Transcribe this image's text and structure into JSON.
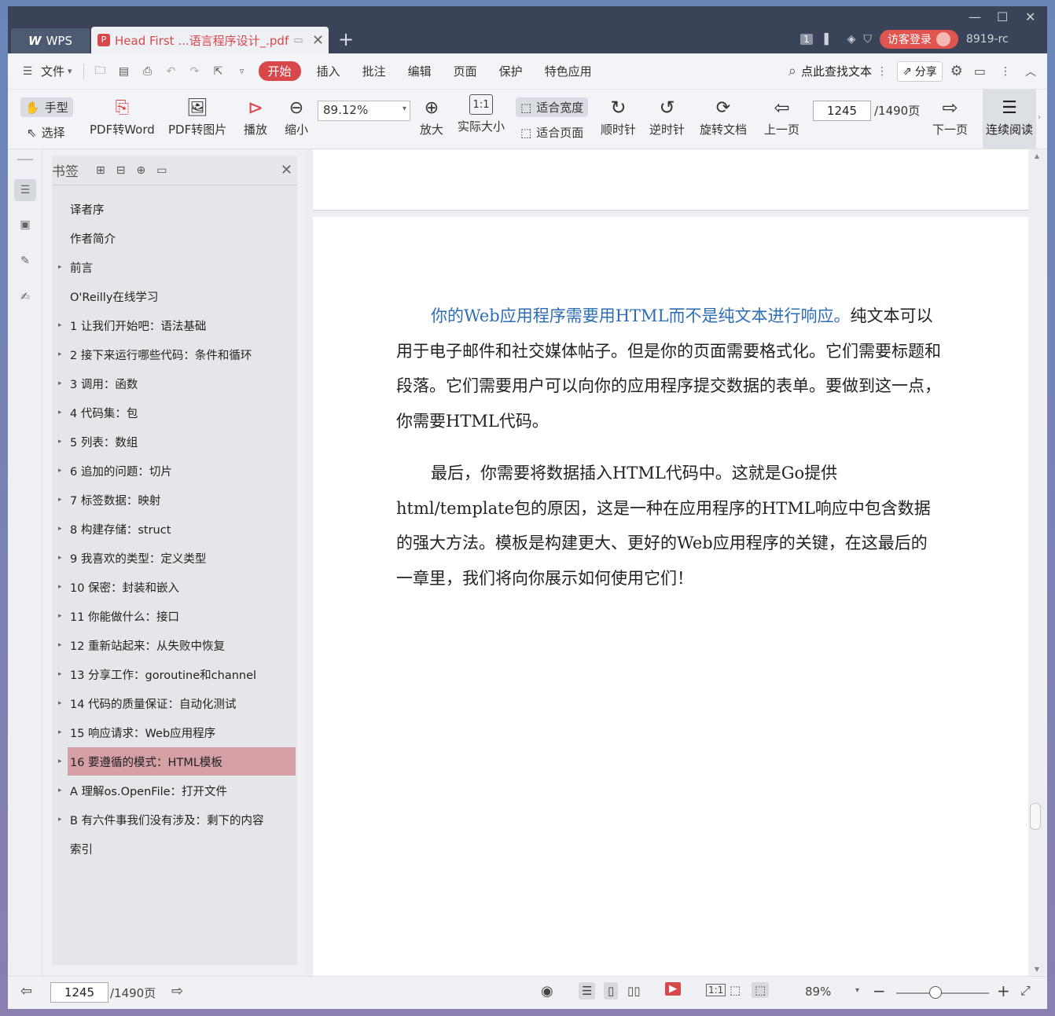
{
  "titlebar": {
    "wps_tab": "WPS",
    "doc_tab": "Head First ...语言程序设计_.pdf",
    "badge": "1",
    "login": "访客登录",
    "build": "8919-rc"
  },
  "menubar": {
    "file": "文件",
    "tabs": [
      "开始",
      "插入",
      "批注",
      "编辑",
      "页面",
      "保护",
      "特色应用"
    ],
    "search": "点此查找文本",
    "share": "分享"
  },
  "ribbon": {
    "hand": "手型",
    "select": "选择",
    "pdf_to_word": "PDF转Word",
    "pdf_to_image": "PDF转图片",
    "play": "播放",
    "zoom_out": "缩小",
    "zoom_value": "89.12%",
    "zoom_in": "放大",
    "actual_size": "实际大小",
    "fit_width": "适合宽度",
    "fit_page": "适合页面",
    "clockwise": "顺时针",
    "counterclockwise": "逆时针",
    "rotate_doc": "旋转文档",
    "prev_page": "上一页",
    "page_value": "1245",
    "page_total": "/1490页",
    "next_page": "下一页",
    "continuous": "连续阅读"
  },
  "bookmarks": {
    "title": "书签",
    "items": [
      {
        "label": "译者序",
        "caret": false
      },
      {
        "label": "作者简介",
        "caret": false
      },
      {
        "label": "前言",
        "caret": true
      },
      {
        "label": "O'Reilly在线学习",
        "caret": false
      },
      {
        "label": "1 让我们开始吧：语法基础",
        "caret": true
      },
      {
        "label": "2 接下来运行哪些代码：条件和循环",
        "caret": true
      },
      {
        "label": "3 调用：函数",
        "caret": true
      },
      {
        "label": "4 代码集：包",
        "caret": true
      },
      {
        "label": "5 列表：数组",
        "caret": true
      },
      {
        "label": "6 追加的问题：切片",
        "caret": true
      },
      {
        "label": "7 标签数据：映射",
        "caret": true
      },
      {
        "label": "8 构建存储：struct",
        "caret": true
      },
      {
        "label": "9 我喜欢的类型：定义类型",
        "caret": true
      },
      {
        "label": "10 保密：封装和嵌入",
        "caret": true
      },
      {
        "label": "11 你能做什么：接口",
        "caret": true
      },
      {
        "label": "12 重新站起来：从失败中恢复",
        "caret": true
      },
      {
        "label": "13 分享工作：goroutine和channel",
        "caret": true
      },
      {
        "label": "14 代码的质量保证：自动化测试",
        "caret": true
      },
      {
        "label": "15 响应请求：Web应用程序",
        "caret": true
      },
      {
        "label": "16 要遵循的模式：HTML模板",
        "caret": true
      },
      {
        "label": "A 理解os.OpenFile：打开文件",
        "caret": true
      },
      {
        "label": "B 有六件事我们没有涉及：剩下的内容",
        "caret": true
      },
      {
        "label": "索引",
        "caret": false
      }
    ],
    "selected_index": 19
  },
  "document": {
    "para1_blue": "你的Web应用程序需要用HTML而不是纯文本进行响应。",
    "para1_rest": "纯文本可以用于电子邮件和社交媒体帖子。但是你的页面需要格式化。它们需要标题和段落。它们需要用户可以向你的应用程序提交数据的表单。要做到这一点，你需要HTML代码。",
    "para2": "最后，你需要将数据插入HTML代码中。这就是Go提供html/template包的原因，这是一种在应用程序的HTML响应中包含数据的强大方法。模板是构建更大、更好的Web应用程序的关键，在这最后的一章里，我们将向你展示如何使用它们！"
  },
  "statusbar": {
    "page_value": "1245",
    "page_total": "/1490页",
    "zoom": "89%"
  },
  "colors": {
    "accent": "#d8484a",
    "titlebar": "#3a4358",
    "selected_bookmark": "#d4a0a6",
    "link_blue": "#2d6db5"
  }
}
